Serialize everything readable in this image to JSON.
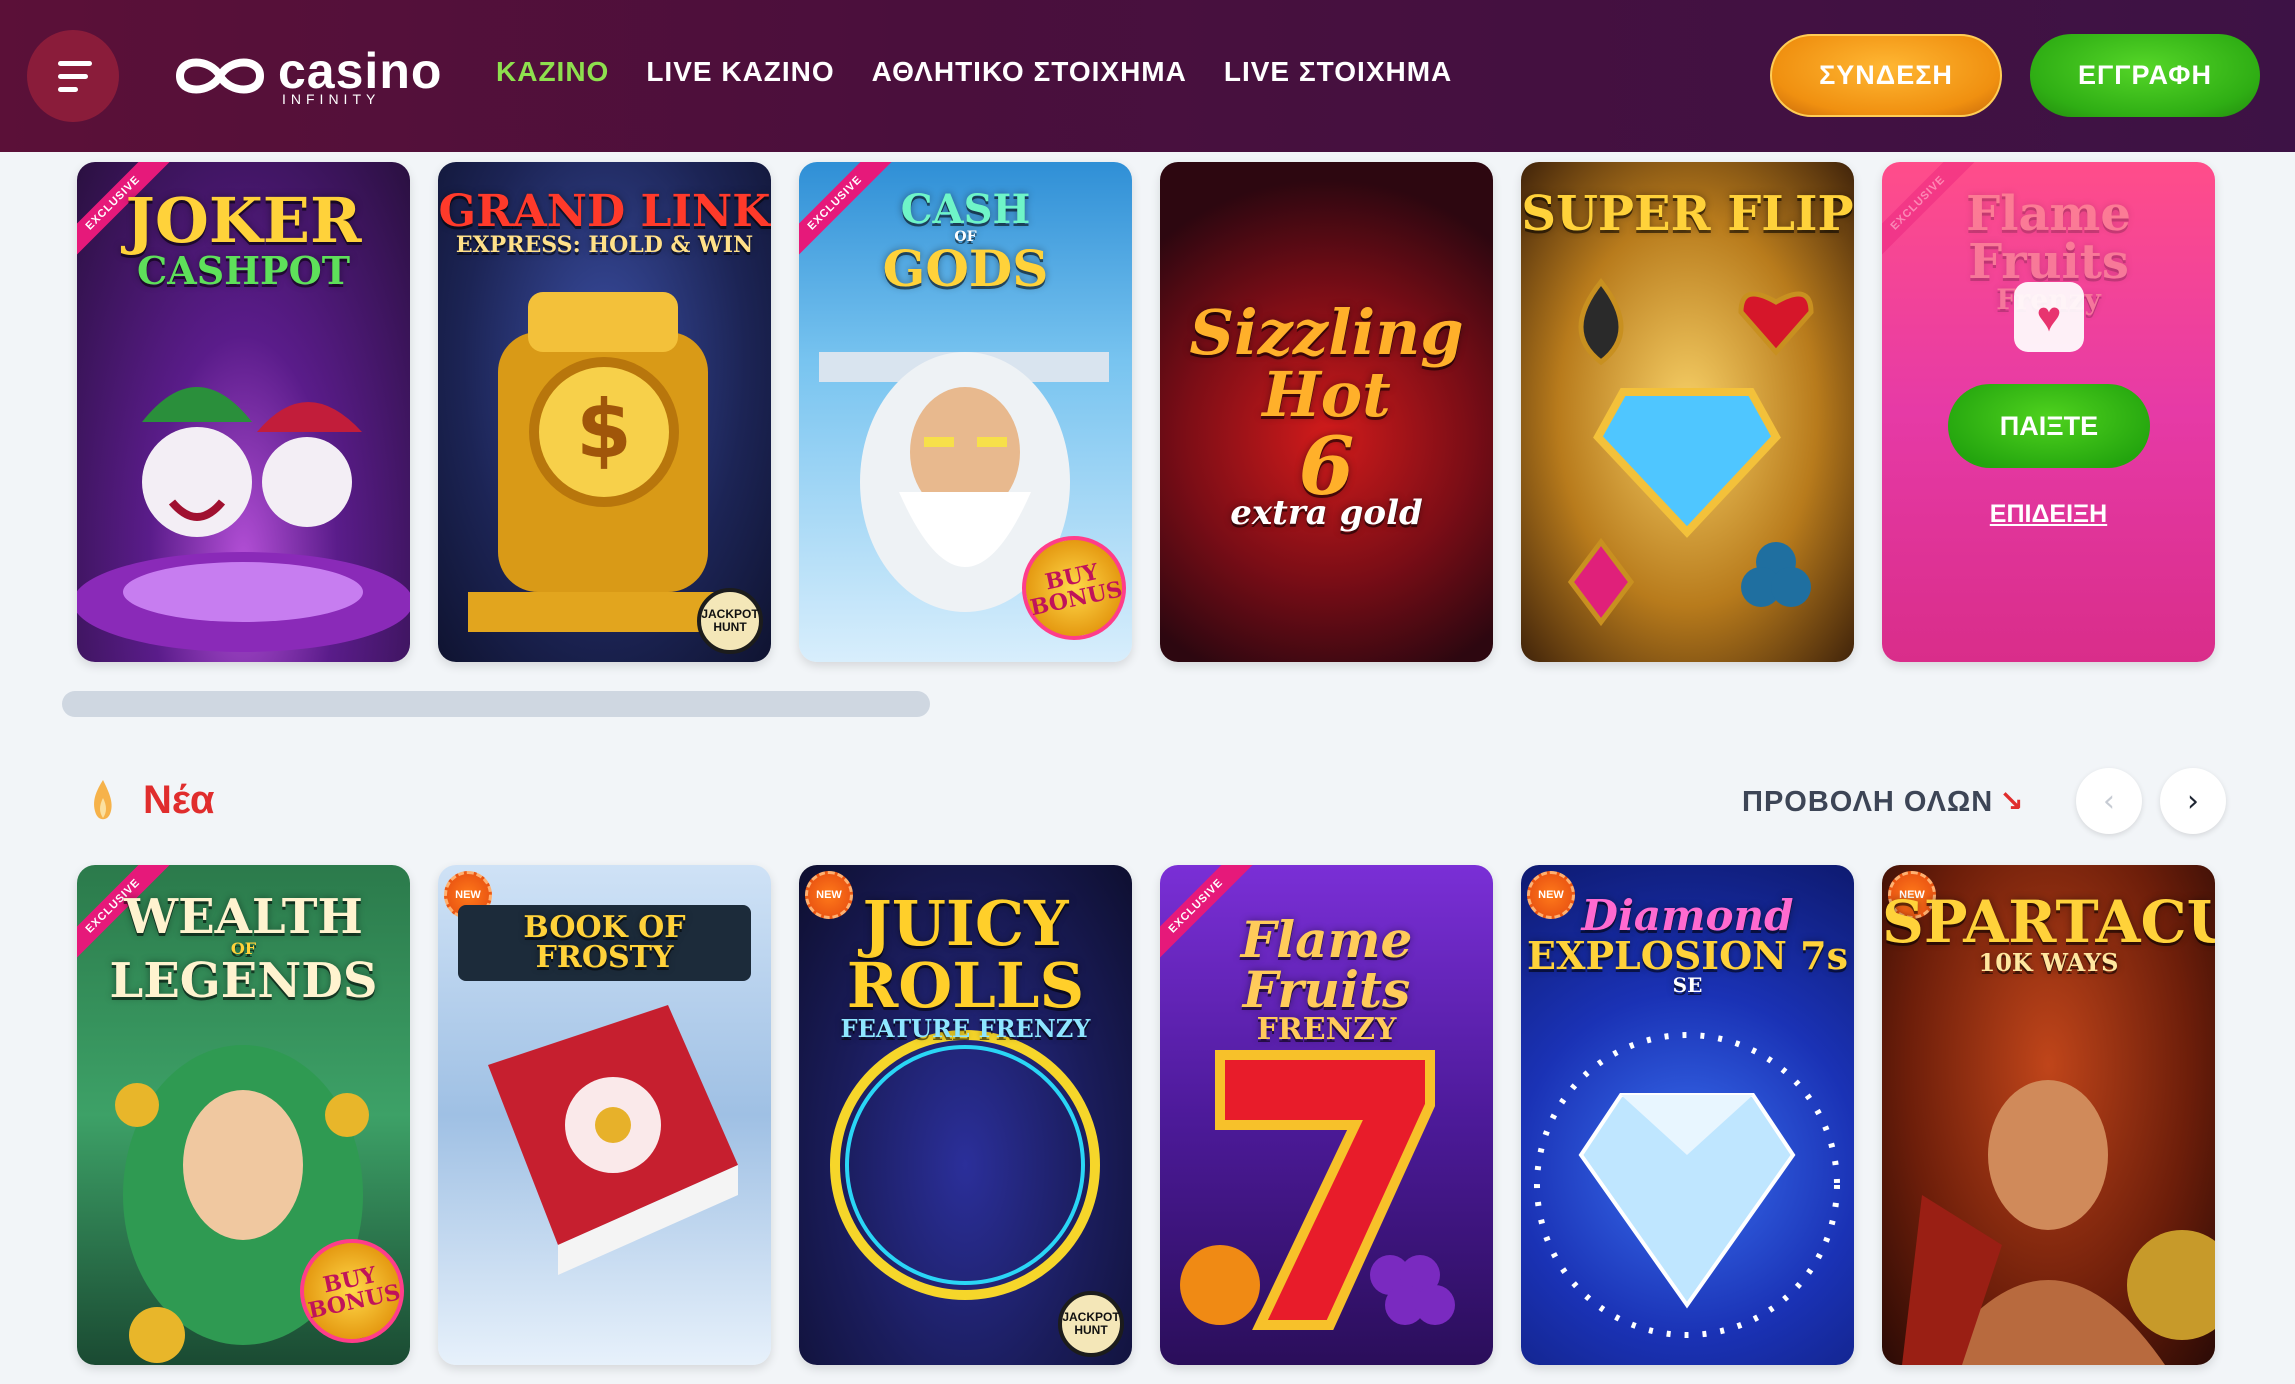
{
  "header": {
    "logo_main": "casino",
    "logo_sub": "INFINITY",
    "nav": [
      {
        "label": "ΚΑΖΙΝΟ",
        "active": true
      },
      {
        "label": "LIVE ΚΑΖΙΝΟ",
        "active": false
      },
      {
        "label": "ΑΘΛΗΤΙΚΟ ΣΤΟΙΧΗΜΑ",
        "active": false
      },
      {
        "label": "LIVE ΣΤΟΙΧΗΜΑ",
        "active": false
      }
    ],
    "login_label": "ΣΥΝΔΕΣΗ",
    "register_label": "ΕΓΓΡΑΦΗ"
  },
  "top_row": [
    {
      "title": "JOKER",
      "title2": "CASHPOT",
      "badge": "EXCLUSIVE"
    },
    {
      "title": "GRAND LINK",
      "title2": "EXPRESS: HOLD & WIN",
      "badge2": "JACKPOT HUNT"
    },
    {
      "title": "CASH",
      "title2": "GODS",
      "title_small": "OF",
      "badge": "EXCLUSIVE",
      "badge2": "BUY BONUS"
    },
    {
      "title": "Sizzling",
      "title2": "Hot",
      "title3": "6",
      "title4": "extra gold"
    },
    {
      "title": "SUPER FLIP"
    },
    {
      "title": "Flame Fruits",
      "title2": "Frenzy",
      "badge": "EXCLUSIVE",
      "play_label": "ΠΑΙΞΤΕ",
      "demo_label": "ΕΠΙΔΕΙΞΗ"
    }
  ],
  "section": {
    "title": "Νέα",
    "view_all": "ΠΡΟΒΟΛΗ ΟΛΩΝ",
    "view_all_arrow": "↘"
  },
  "new_row": [
    {
      "title": "WEALTH",
      "title_small": "OF",
      "title2": "LEGENDS",
      "badge": "EXCLUSIVE",
      "badge2": "BUY BONUS"
    },
    {
      "title": "BOOK OF FROSTY",
      "badge": "NEW"
    },
    {
      "title": "JUICY",
      "title2": "ROLLS",
      "title3": "FEATURE FRENZY",
      "badge": "NEW",
      "badge2": "JACKPOT HUNT"
    },
    {
      "title": "Flame Fruits",
      "title2": "FRENZY",
      "badge": "EXCLUSIVE"
    },
    {
      "title": "Diamond",
      "title2": "EXPLOSION 7s",
      "title3": "SE",
      "badge": "NEW"
    },
    {
      "title": "SPARTACUS",
      "title2": "10K WAYS",
      "badge": "NEW"
    }
  ],
  "icons": {
    "menu": "hamburger-icon",
    "heart": "heart-icon",
    "flame": "flame-icon",
    "prev": "chevron-left-icon",
    "next": "chevron-right-icon"
  },
  "colors": {
    "header_bg": "#4a0f3c",
    "nav_active": "#8ee04e",
    "login": "#f09010",
    "register": "#2fae14",
    "section_title": "#e02d2d"
  }
}
